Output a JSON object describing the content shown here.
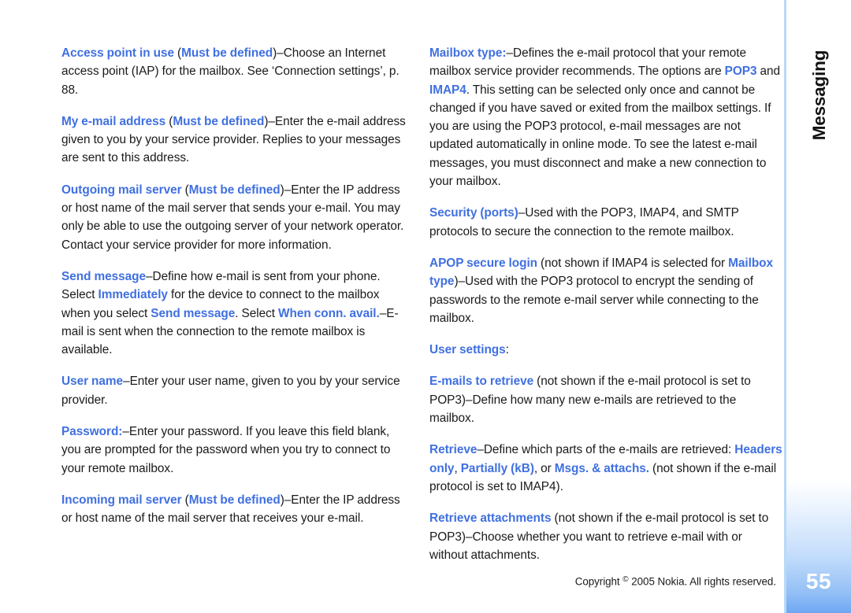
{
  "document": {
    "section_label": "Messaging",
    "page_number": "55",
    "footer": {
      "copyright_prefix": "Copyright ",
      "copyright_mark": "©",
      "copyright_suffix": " 2005 Nokia. All rights reserved."
    },
    "accent_color": "#4070e0",
    "rule_color": "#b9d9f7",
    "tab_color": "#6ea7f2"
  },
  "left_column": {
    "paragraphs": [
      {
        "id": "access-point-in-use",
        "runs": [
          {
            "style": "hl",
            "text": "Access point in use"
          },
          {
            "style": "blk",
            "text": " ("
          },
          {
            "style": "hl",
            "text": "Must be defined"
          },
          {
            "style": "blk",
            "text": ")–Choose an Internet access point (IAP) for the mailbox. See ‘Connection settings’, p. 88."
          }
        ]
      },
      {
        "id": "my-e-mail-address",
        "runs": [
          {
            "style": "hl",
            "text": "My e-mail address"
          },
          {
            "style": "blk",
            "text": " ("
          },
          {
            "style": "hl",
            "text": "Must be defined"
          },
          {
            "style": "blk",
            "text": ")–Enter the e-mail address given to you by your service provider. Replies to your messages are sent to this address."
          }
        ]
      },
      {
        "id": "outgoing-mail-server",
        "runs": [
          {
            "style": "hl",
            "text": "Outgoing mail server"
          },
          {
            "style": "blk",
            "text": " ("
          },
          {
            "style": "hl",
            "text": "Must be defined"
          },
          {
            "style": "blk",
            "text": ")–Enter the IP address or host name of the mail server that sends your e-mail. You may only be able to use the outgoing server of your network operator. Contact your service provider for more information."
          }
        ]
      },
      {
        "id": "send-message",
        "runs": [
          {
            "style": "hl",
            "text": "Send message"
          },
          {
            "style": "blk",
            "text": "–Define how e-mail is sent from your phone. Select "
          },
          {
            "style": "hl",
            "text": "Immediately"
          },
          {
            "style": "blk",
            "text": " for the device to connect to the mailbox when you select "
          },
          {
            "style": "hl",
            "text": "Send message"
          },
          {
            "style": "blk",
            "text": ". Select "
          },
          {
            "style": "hl",
            "text": "When conn. avail."
          },
          {
            "style": "blk",
            "text": "–E-mail is sent when the connection to the remote mailbox is available."
          }
        ]
      },
      {
        "id": "user-name",
        "runs": [
          {
            "style": "hl",
            "text": "User name"
          },
          {
            "style": "blk",
            "text": "–Enter your user name, given to you by your service provider."
          }
        ]
      },
      {
        "id": "password",
        "runs": [
          {
            "style": "hl",
            "text": "Password:"
          },
          {
            "style": "blk",
            "text": "–Enter your password. If you leave this field blank, you are prompted for the password when you try to connect to your remote mailbox."
          }
        ]
      },
      {
        "id": "incoming-mail-server",
        "runs": [
          {
            "style": "hl",
            "text": "Incoming mail server"
          },
          {
            "style": "blk",
            "text": " ("
          },
          {
            "style": "hl",
            "text": "Must be defined"
          },
          {
            "style": "blk",
            "text": ")–Enter the IP address or host name of the mail server that receives your e-mail."
          }
        ]
      }
    ]
  },
  "right_column": {
    "paragraphs": [
      {
        "id": "mailbox-type",
        "runs": [
          {
            "style": "hl",
            "text": "Mailbox type:"
          },
          {
            "style": "blk",
            "text": "–Defines the e-mail protocol that your remote mailbox service provider recommends. The options are "
          },
          {
            "style": "hl",
            "text": "POP3"
          },
          {
            "style": "blk",
            "text": " and "
          },
          {
            "style": "hl",
            "text": "IMAP4"
          },
          {
            "style": "blk",
            "text": ". This setting can be selected only once and cannot be changed if you have saved or exited from the mailbox settings. If you are using the POP3 protocol, e-mail messages are not updated automatically in online mode. To see the latest e-mail messages, you must disconnect and make a new connection to your mailbox."
          }
        ]
      },
      {
        "id": "security-ports",
        "runs": [
          {
            "style": "hl",
            "text": "Security (ports)"
          },
          {
            "style": "blk",
            "text": "–Used with the POP3, IMAP4, and SMTP protocols to secure the connection to the remote mailbox."
          }
        ]
      },
      {
        "id": "apop-secure-login",
        "runs": [
          {
            "style": "hl",
            "text": "APOP secure login"
          },
          {
            "style": "blk",
            "text": " (not shown if IMAP4 is selected for "
          },
          {
            "style": "hl",
            "text": "Mailbox type"
          },
          {
            "style": "blk",
            "text": ")–Used with the POP3 protocol to encrypt the sending of passwords to the remote e-mail server while connecting to the mailbox."
          }
        ]
      },
      {
        "id": "user-settings",
        "runs": [
          {
            "style": "hl",
            "text": "User settings"
          },
          {
            "style": "blk",
            "text": ":"
          }
        ]
      },
      {
        "id": "e-mails-to-retrieve",
        "runs": [
          {
            "style": "hl",
            "text": "E-mails to retrieve"
          },
          {
            "style": "blk",
            "text": " (not shown if the e-mail protocol is set to POP3)–Define how many new e-mails are retrieved to the mailbox."
          }
        ]
      },
      {
        "id": "retrieve",
        "runs": [
          {
            "style": "hl",
            "text": "Retrieve"
          },
          {
            "style": "blk",
            "text": "–Define which parts of the e-mails are retrieved: "
          },
          {
            "style": "hl",
            "text": "Headers only"
          },
          {
            "style": "blk",
            "text": ", "
          },
          {
            "style": "hl",
            "text": "Partially (kB)"
          },
          {
            "style": "blk",
            "text": ", or "
          },
          {
            "style": "hl",
            "text": "Msgs. & attachs."
          },
          {
            "style": "blk",
            "text": " (not shown if the e-mail protocol is set to IMAP4)."
          }
        ]
      },
      {
        "id": "retrieve-attachments",
        "runs": [
          {
            "style": "hl",
            "text": "Retrieve attachments"
          },
          {
            "style": "blk",
            "text": " (not shown if the e-mail protocol is set to POP3)–Choose whether you want to retrieve e-mail with or without attachments."
          }
        ]
      }
    ]
  }
}
